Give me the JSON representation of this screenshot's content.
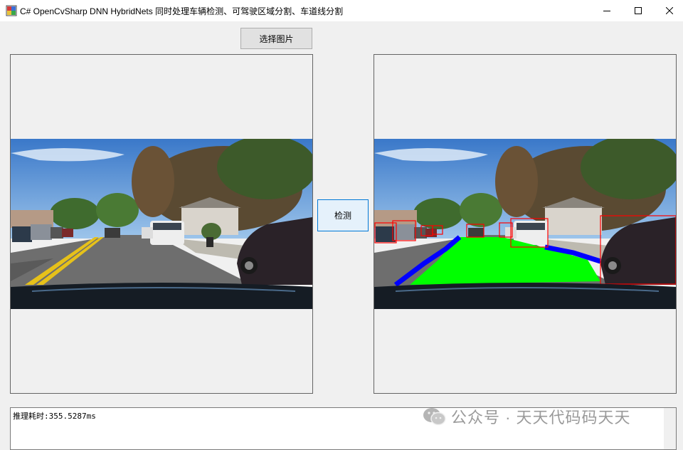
{
  "window": {
    "title": "C# OpenCvSharp DNN HybridNets 同时处理车辆检测、可驾驶区域分割、车道线分割"
  },
  "buttons": {
    "select_image": "选择图片",
    "detect": "检测"
  },
  "output": {
    "text": "推理耗时:355.5287ms"
  },
  "watermark": {
    "text": "公众号 · 天天代码码天天"
  },
  "colors": {
    "drivable_area": "#00ff00",
    "lane_line": "#0000ff",
    "vehicle_box": "#ff0000"
  }
}
